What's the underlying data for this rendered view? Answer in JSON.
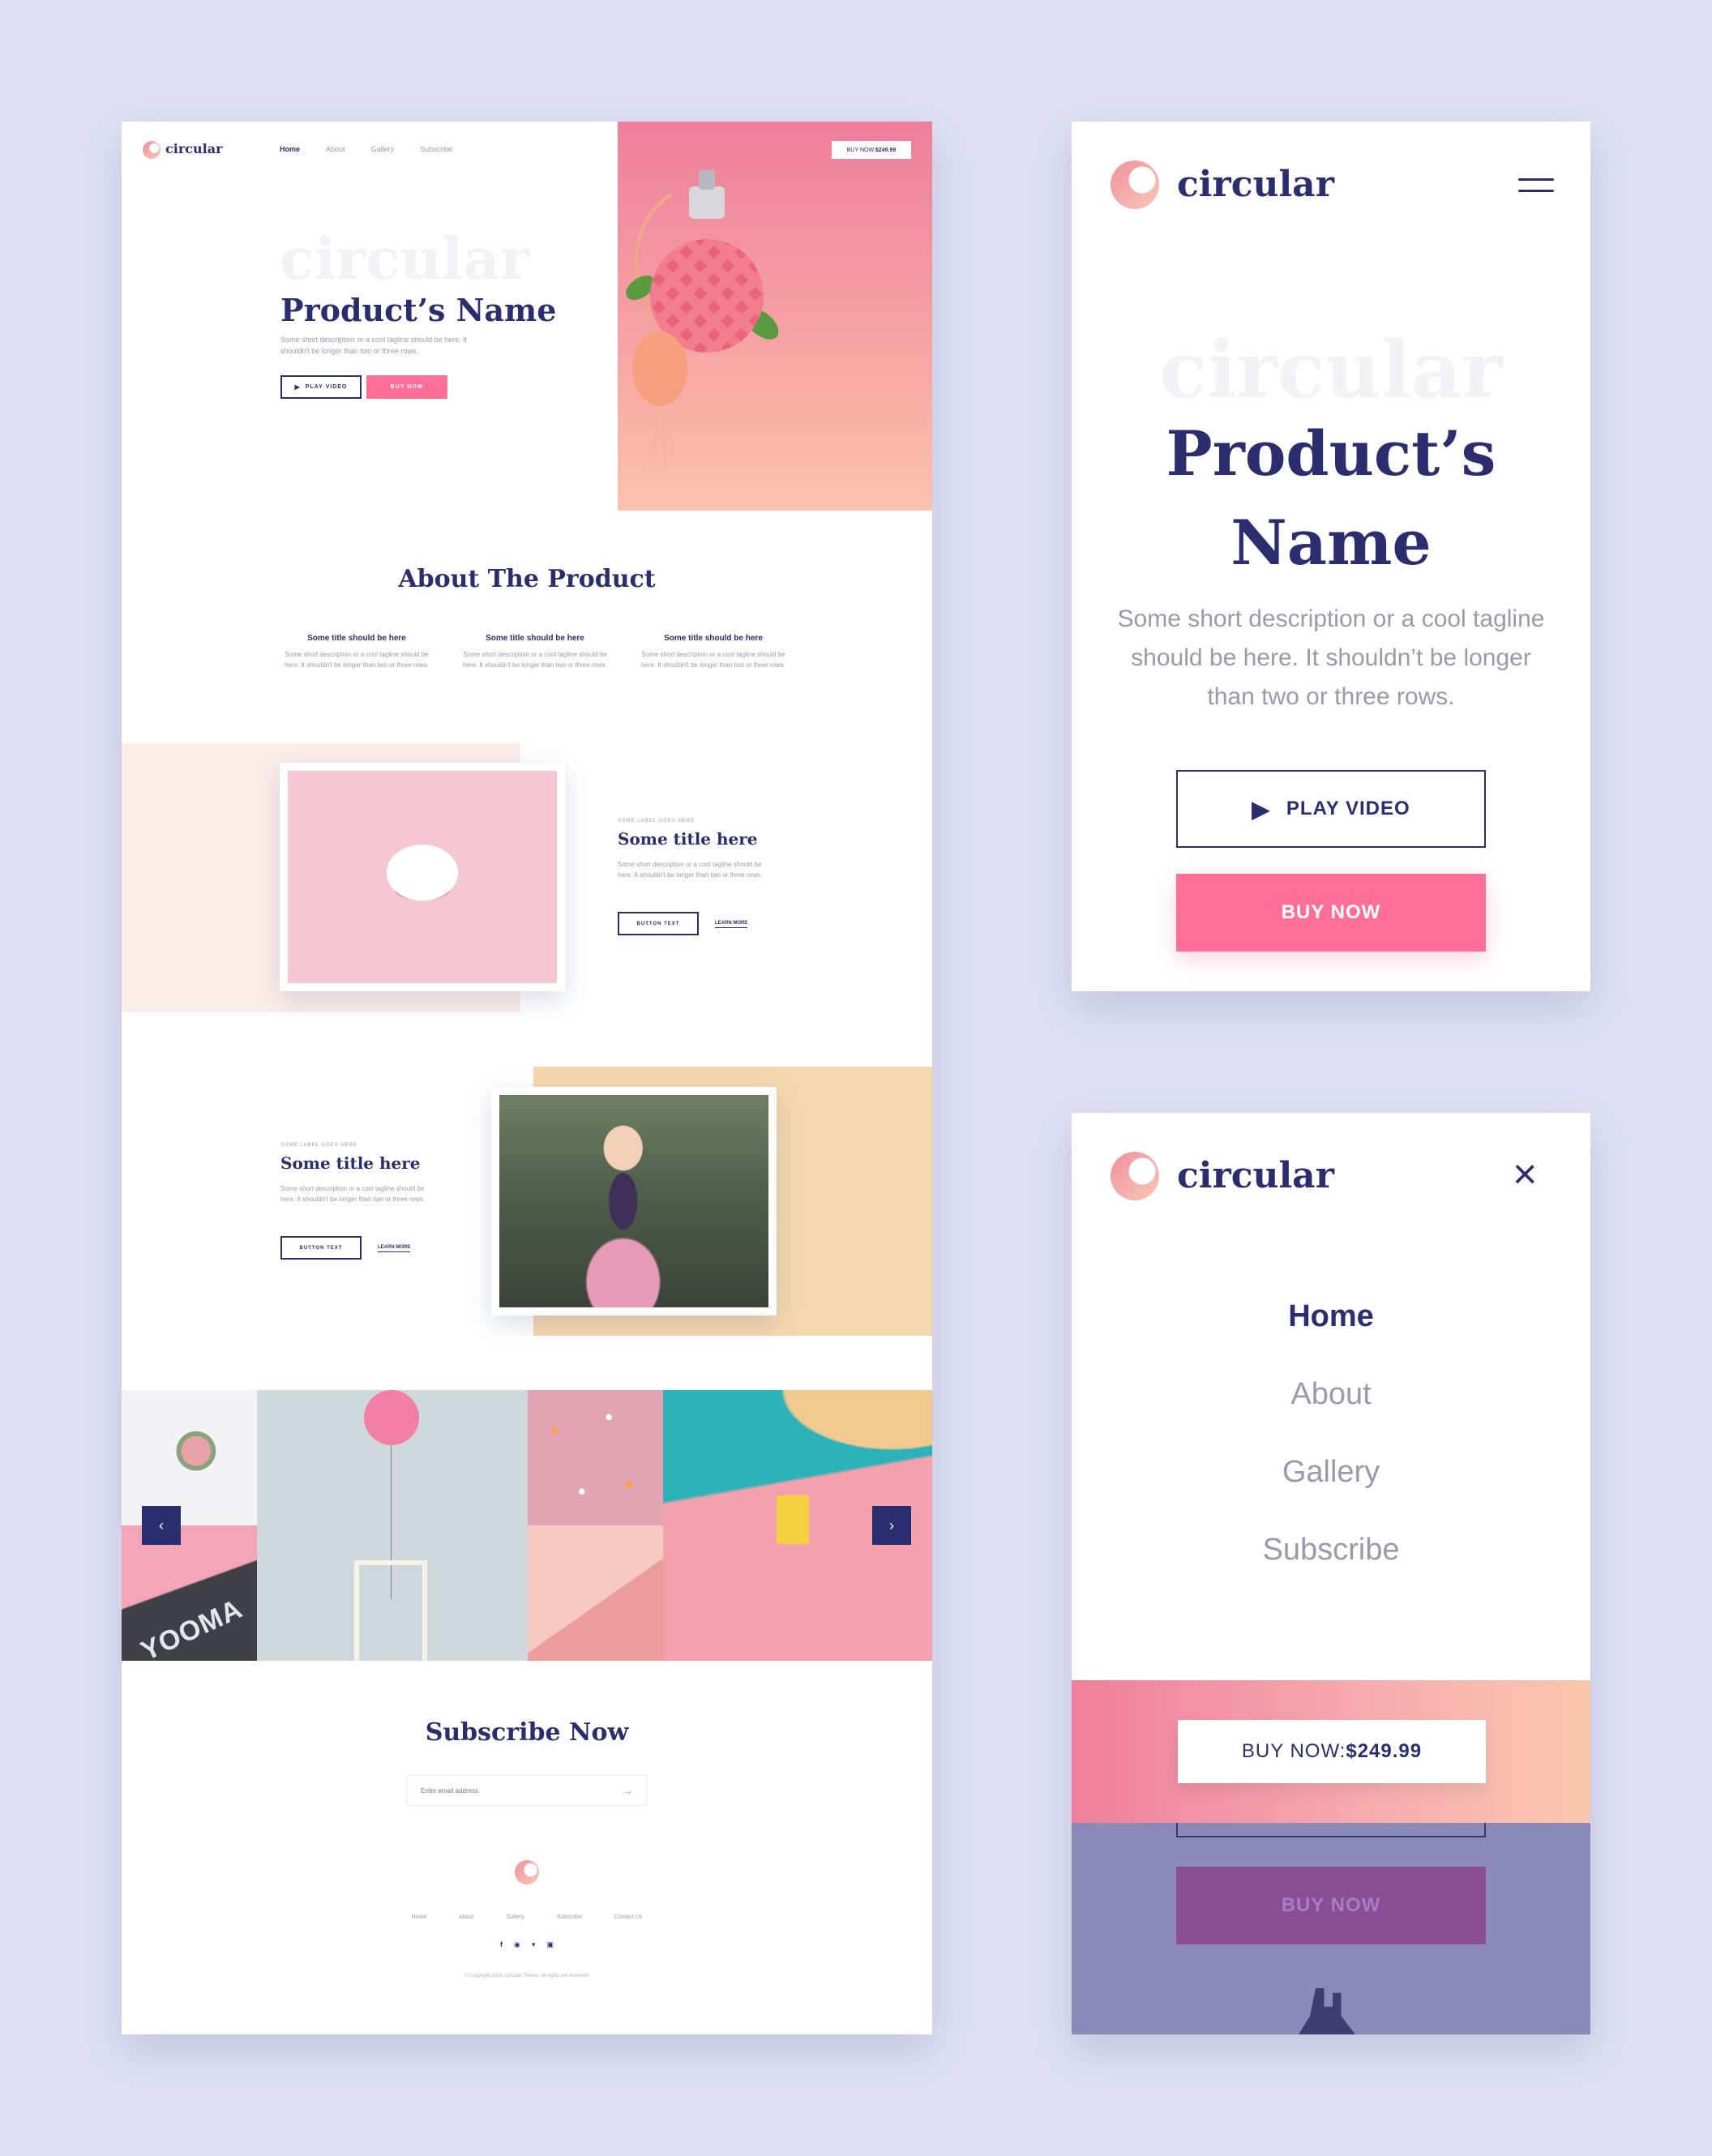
{
  "brand": "circular",
  "colors": {
    "navy": "#2a2e6e",
    "pink": "#ff6f98",
    "peach": "#fbe9e2",
    "sand": "#f4d8ad",
    "background": "#dfe1f2"
  },
  "desktop": {
    "nav": [
      "Home",
      "About",
      "Gallery",
      "Subscribe"
    ],
    "buy_now": "BUY NOW: ",
    "price": "$249.99",
    "hero": {
      "watermark": "circular",
      "title": "Product’s Name",
      "description": "Some short description or a cool tagline should be here. It shouldn't be longer than two or three rows.",
      "play_video": "PLAY VIDEO",
      "buy_now": "BUY NOW"
    },
    "about": {
      "title": "About The Product",
      "features": [
        {
          "title": "Some title should be here",
          "text": "Some short description or a cool tagline should be here. It shouldn't be longer than two or three rows."
        },
        {
          "title": "Some title should be here",
          "text": "Some short description or a cool tagline should be here. It shouldn't be longer than two or three rows."
        },
        {
          "title": "Some title should be here",
          "text": "Some short description or a cool tagline should be here. It shouldn't be longer than two or three rows."
        }
      ]
    },
    "feature1": {
      "label": "SOME LABEL GOES HERE",
      "title": "Some title here",
      "text": "Some short description or a cool tagline should be here. It shouldn't be longer than two or three rows.",
      "button": "BUTTON TEXT",
      "link": "LEARN MORE"
    },
    "feature2": {
      "label": "SOME LABEL GOES HERE",
      "title": "Some title here",
      "text": "Some short description or a cool tagline should be here. It shouldn't be longer than two or three rows.",
      "button": "BUTTON TEXT",
      "link": "LEARN MORE"
    },
    "gallery": {
      "prev_icon": "chevron-left-icon",
      "next_icon": "chevron-right-icon",
      "sign_text": "YOOMA"
    },
    "subscribe": {
      "title": "Subscribe Now",
      "placeholder": "Enter email address"
    },
    "footer": {
      "links": [
        "Home",
        "About",
        "Gallery",
        "Subscribe",
        "Contact Us"
      ],
      "social": [
        "facebook-icon",
        "pinterest-icon",
        "twitter-icon",
        "instagram-icon"
      ],
      "copyright": "© Copyright 2018. Circular Theme. All rights are reserved."
    }
  },
  "mobile_hero": {
    "watermark": "circular",
    "title_line1": "Product’s",
    "title_line2": "Name",
    "description": "Some short description or a cool tagline should be here. It shouldn’t be longer than two or three rows.",
    "play_video": "PLAY VIDEO",
    "buy_now": "BUY NOW"
  },
  "mobile_menu": {
    "items": [
      "Home",
      "About",
      "Gallery",
      "Subscribe"
    ],
    "buy_now": "BUY NOW: ",
    "price": "$249.99",
    "buy_now_ghost": "BUY NOW"
  }
}
